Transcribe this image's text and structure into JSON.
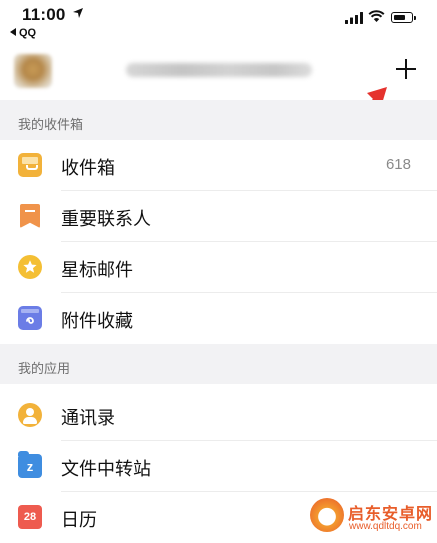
{
  "status_bar": {
    "time": "11:00",
    "back_app": "QQ"
  },
  "header": {
    "add_label": "+"
  },
  "sections": [
    {
      "title": "我的收件箱",
      "items": [
        {
          "label": "收件箱",
          "count": "618",
          "icon": "inbox-icon",
          "color": "#f2b23a"
        },
        {
          "label": "重要联系人",
          "icon": "vip-contacts-icon",
          "color": "#f0934a"
        },
        {
          "label": "星标邮件",
          "icon": "star-icon",
          "color": "#f4bf34"
        },
        {
          "label": "附件收藏",
          "icon": "attachment-icon",
          "color": "#6b7de6"
        }
      ]
    },
    {
      "title": "我的应用",
      "items": [
        {
          "label": "通讯录",
          "icon": "contacts-icon",
          "color": "#f2b23a"
        },
        {
          "label": "文件中转站",
          "icon": "file-transfer-icon",
          "badge": "z",
          "color": "#3f8de0"
        },
        {
          "label": "日历",
          "icon": "calendar-icon",
          "badge": "28",
          "color": "#ee5b4f"
        }
      ]
    }
  ],
  "watermark": {
    "title": "启东安卓网",
    "url": "www.qdltdq.com"
  },
  "annotation": {
    "arrow_color": "#e5322d"
  }
}
